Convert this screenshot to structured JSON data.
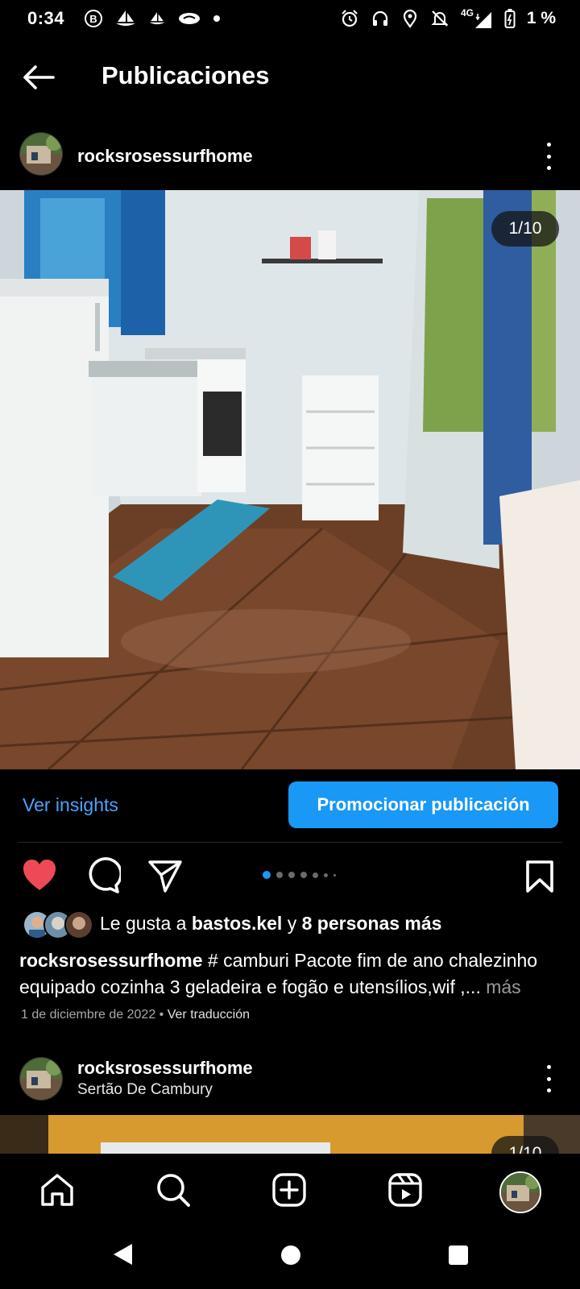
{
  "status_bar": {
    "time": "0:34",
    "network": "4G",
    "battery": "1 %"
  },
  "header": {
    "title": "Publicaciones"
  },
  "post": {
    "username": "rocksrosessurfhome",
    "photo_counter": "1/10",
    "carousel_count": 10,
    "carousel_active_index": 0,
    "insights_label": "Ver insights",
    "promote_label": "Promocionar publicación",
    "liked": true,
    "likes": {
      "prefix": "Le gusta a ",
      "user": "bastos.kel",
      "joiner": " y ",
      "others": "8 personas más"
    },
    "caption": {
      "username": "rocksrosessurfhome",
      "text": " # camburi Pacote fim de ano chalezinho equipado cozinha 3 geladeira e fogão e utensílios,wif ,...",
      "more": " más"
    },
    "date": "1 de diciembre de 2022",
    "date_separator": " • ",
    "translate_label": "Ver traducción"
  },
  "post2": {
    "username": "rocksrosessurfhome",
    "location": "Sertão De Cambury",
    "photo_counter": "1/10"
  },
  "bottom_nav": {
    "items": [
      {
        "icon": "home-icon"
      },
      {
        "icon": "search-icon"
      },
      {
        "icon": "add-post-icon"
      },
      {
        "icon": "reels-icon"
      },
      {
        "icon": "profile-avatar"
      }
    ]
  },
  "colors": {
    "background": "#000000",
    "accent": "#1a98f5",
    "link": "#4aa3ff",
    "like": "#ed4956"
  }
}
